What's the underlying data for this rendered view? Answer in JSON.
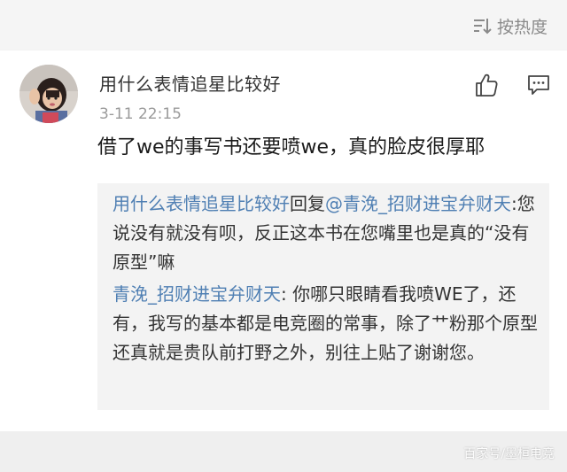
{
  "sort": {
    "label": "按热度",
    "icon": "sort-icon"
  },
  "comment": {
    "user": "用什么表情追星比较好",
    "time": "3-11 22:15",
    "text": "借了we的事写书还要喷we，真的脸皮很厚耶",
    "like_icon": "thumbs-up-icon",
    "reply_icon": "comment-icon",
    "replies": [
      {
        "author": "用什么表情追星比较好",
        "verb": "回复",
        "mention": "@青浼_招财进宝弁财天",
        "separator": ":",
        "text": "您说没有就没有呗，反正这本书在您嘴里也是真的“没有原型”嘛"
      },
      {
        "author": "青浼_招财进宝弁财天",
        "separator": ": ",
        "text": "你哪只眼睛看我喷WE了，还有，我写的基本都是电竞圈的常事，除了艹粉那个原型还真就是贵队前打野之外，别往上贴了谢谢您。"
      }
    ]
  },
  "watermark": "百家号/墨桓电竞",
  "colors": {
    "link": "#4f7fb3",
    "text": "#1a1a1a",
    "meta": "#9b9b9b",
    "reply_bg": "#f3f3f3"
  }
}
